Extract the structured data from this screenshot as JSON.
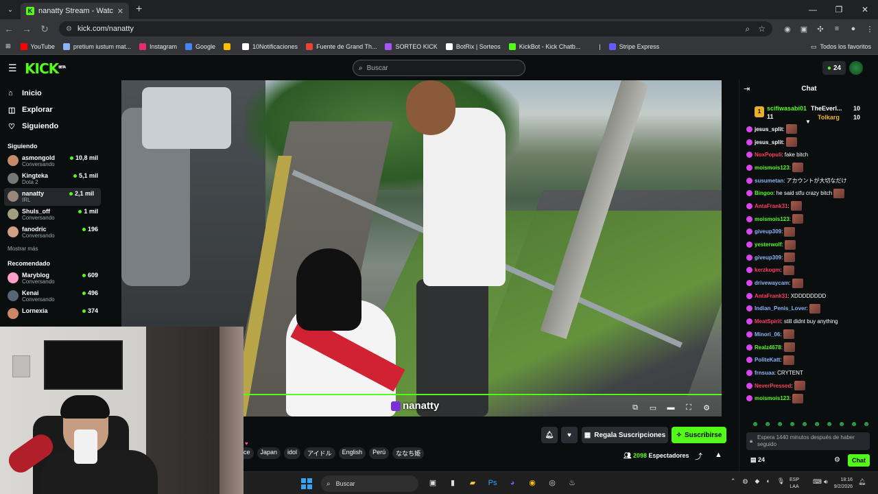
{
  "browser": {
    "tab_title": "nanatty Stream - Watch Live on Kick",
    "url": "kick.com/nanatty",
    "bookmarks": [
      {
        "label": "YouTube",
        "color": "#ff0000"
      },
      {
        "label": "pretium iustum mat...",
        "color": "#8ab4f8"
      },
      {
        "label": "Instagram",
        "color": "#e1306c"
      },
      {
        "label": "Google",
        "color": "#4285f4"
      },
      {
        "label": "",
        "color": "#fbbc05"
      },
      {
        "label": "10Notificaciones",
        "color": "#ffffff"
      },
      {
        "label": "Fuente de Grand Th...",
        "color": "#ea4335"
      },
      {
        "label": "SORTEO KICK",
        "color": "#a855f7"
      },
      {
        "label": "BotRix | Sorteos",
        "color": "#ffffff"
      },
      {
        "label": "KickBot - Kick Chatb...",
        "color": "#53fc18"
      },
      {
        "label": "|",
        "color": "transparent"
      },
      {
        "label": "Stripe Express",
        "color": "#635bff"
      }
    ],
    "bookmarks_all": "Todos los favoritos"
  },
  "kick": {
    "logo": "KICK",
    "logo_badge": "BETA",
    "search_placeholder": "Buscar",
    "header_count": "24",
    "nav": [
      {
        "label": "Inicio",
        "icon": "home-icon",
        "glyph": "⌂"
      },
      {
        "label": "Explorar",
        "icon": "explore-icon",
        "glyph": "◫"
      },
      {
        "label": "Siguiendo",
        "icon": "heart-icon",
        "glyph": "♡"
      }
    ],
    "following_title": "Siguiendo",
    "following": [
      {
        "name": "asmongold",
        "category": "Conversando",
        "viewers": "10,8 mil",
        "color": "#c58a6a"
      },
      {
        "name": "Kingteka",
        "category": "Dota 2",
        "viewers": "5,1 mil",
        "color": "#777777"
      },
      {
        "name": "nanatty",
        "category": "IRL",
        "viewers": "2,1 mil",
        "color": "#998877"
      },
      {
        "name": "Shuls_off",
        "category": "Conversando",
        "viewers": "1 mil",
        "color": "#a0a080"
      },
      {
        "name": "fanodric",
        "category": "Conversando",
        "viewers": "196",
        "color": "#d0a080"
      }
    ],
    "show_more": "Mostrar más",
    "recommended_title": "Recomendado",
    "recommended": [
      {
        "name": "Maryblog",
        "category": "Conversando",
        "viewers": "609",
        "color": "#ff9ec7"
      },
      {
        "name": "Kenai",
        "category": "Conversando",
        "viewers": "496",
        "color": "#556677"
      },
      {
        "name": "Lornexia",
        "category": "",
        "viewers": "374",
        "color": "#cc8866"
      }
    ],
    "watermark": "nanatty",
    "tags": [
      "nce",
      "Japan",
      "idol",
      "アイドル",
      "English",
      "Perú",
      "ななち姫"
    ],
    "gift_label": "Regala Suscripciones",
    "subscribe_label": "Suscribirse",
    "viewers_count": "2098",
    "viewers_label": "Espectadores"
  },
  "chat": {
    "title": "Chat",
    "leaders": [
      {
        "name": "scifiwasabi01",
        "value": "11",
        "color": "#53fc18"
      },
      {
        "name": "TheEverl...",
        "value": "10",
        "color": "#ffffff"
      },
      {
        "name": "Tolkarg",
        "value": "10",
        "color": "#f0b429"
      }
    ],
    "messages": [
      {
        "user": "jesus_split",
        "color": "#ffffff",
        "text": "",
        "emote": true
      },
      {
        "user": "jesus_split",
        "color": "#ffffff",
        "text": "",
        "emote": true
      },
      {
        "user": "NoxPopuli",
        "color": "#ff3b5c",
        "text": "fake bitch",
        "emote": false
      },
      {
        "user": "moismois123",
        "color": "#53fc18",
        "text": "",
        "emote": true
      },
      {
        "user": "susumetan",
        "color": "#8ab4f8",
        "text": "アカウントが大切なだけ",
        "emote": false
      },
      {
        "user": "Bingoo",
        "color": "#53fc18",
        "text": "he said stfu crazy bitch",
        "emote": true
      },
      {
        "user": "AntaFrank31",
        "color": "#ff3b5c",
        "text": "",
        "emote": true
      },
      {
        "user": "moismois123",
        "color": "#53fc18",
        "text": "",
        "emote": true
      },
      {
        "user": "giveup309",
        "color": "#8ab4f8",
        "text": "",
        "emote": true
      },
      {
        "user": "yesterwolf",
        "color": "#53fc18",
        "text": "",
        "emote": true
      },
      {
        "user": "giveup309",
        "color": "#8ab4f8",
        "text": "",
        "emote": true
      },
      {
        "user": "kerzkogm",
        "color": "#ff3b5c",
        "text": "",
        "emote": true
      },
      {
        "user": "drivewaycam",
        "color": "#8ab4f8",
        "text": "",
        "emote": true
      },
      {
        "user": "AntaFrank31",
        "color": "#ff3b5c",
        "text": "XDDDDDDDD",
        "emote": false
      },
      {
        "user": "Indian_Penis_Lover",
        "color": "#8ab4f8",
        "text": "",
        "emote": true
      },
      {
        "user": "MeatSpirit",
        "color": "#ff3b5c",
        "text": "still didnt buy anything",
        "emote": false
      },
      {
        "user": "Minori_06",
        "color": "#8ab4f8",
        "text": "",
        "emote": true
      },
      {
        "user": "Realz4678",
        "color": "#53fc18",
        "text": "",
        "emote": true
      },
      {
        "user": "PoliteKatt",
        "color": "#8ab4f8",
        "text": "",
        "emote": true
      },
      {
        "user": "frnsuaa",
        "color": "#8ab4f8",
        "text": "CRYTENT",
        "emote": false
      },
      {
        "user": "NeverPressed",
        "color": "#ff3b5c",
        "text": "",
        "emote": true
      },
      {
        "user": "moismois123",
        "color": "#53fc18",
        "text": "",
        "emote": true
      }
    ],
    "input_placeholder": "Espera 1440 minutos después de haber seguido",
    "footer_count": "24",
    "send_label": "Chat"
  },
  "taskbar": {
    "search_label": "Buscar",
    "lang_line1": "ESP",
    "lang_line2": "LAA",
    "time": "18:16",
    "date": "9/2/2026"
  }
}
